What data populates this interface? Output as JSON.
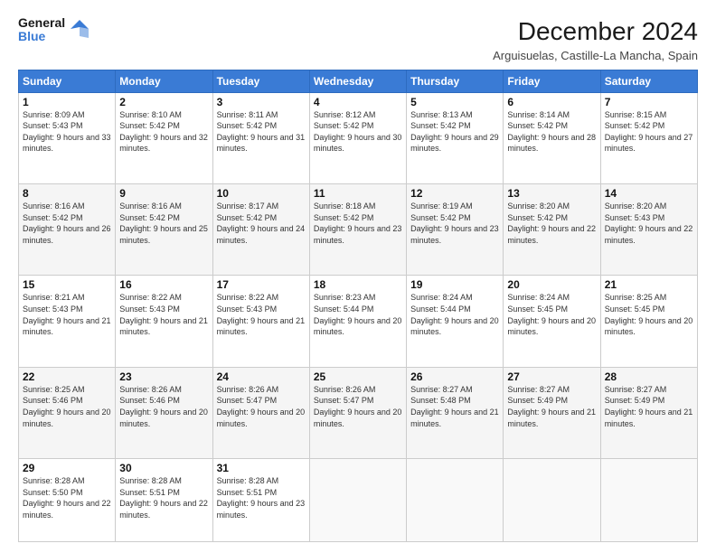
{
  "header": {
    "logo_line1": "General",
    "logo_line2": "Blue",
    "title": "December 2024",
    "subtitle": "Arguisuelas, Castille-La Mancha, Spain"
  },
  "days_of_week": [
    "Sunday",
    "Monday",
    "Tuesday",
    "Wednesday",
    "Thursday",
    "Friday",
    "Saturday"
  ],
  "weeks": [
    [
      {
        "day": 1,
        "sunrise": "8:09 AM",
        "sunset": "5:43 PM",
        "daylight": "9 hours and 33 minutes."
      },
      {
        "day": 2,
        "sunrise": "8:10 AM",
        "sunset": "5:42 PM",
        "daylight": "9 hours and 32 minutes."
      },
      {
        "day": 3,
        "sunrise": "8:11 AM",
        "sunset": "5:42 PM",
        "daylight": "9 hours and 31 minutes."
      },
      {
        "day": 4,
        "sunrise": "8:12 AM",
        "sunset": "5:42 PM",
        "daylight": "9 hours and 30 minutes."
      },
      {
        "day": 5,
        "sunrise": "8:13 AM",
        "sunset": "5:42 PM",
        "daylight": "9 hours and 29 minutes."
      },
      {
        "day": 6,
        "sunrise": "8:14 AM",
        "sunset": "5:42 PM",
        "daylight": "9 hours and 28 minutes."
      },
      {
        "day": 7,
        "sunrise": "8:15 AM",
        "sunset": "5:42 PM",
        "daylight": "9 hours and 27 minutes."
      }
    ],
    [
      {
        "day": 8,
        "sunrise": "8:16 AM",
        "sunset": "5:42 PM",
        "daylight": "9 hours and 26 minutes."
      },
      {
        "day": 9,
        "sunrise": "8:16 AM",
        "sunset": "5:42 PM",
        "daylight": "9 hours and 25 minutes."
      },
      {
        "day": 10,
        "sunrise": "8:17 AM",
        "sunset": "5:42 PM",
        "daylight": "9 hours and 24 minutes."
      },
      {
        "day": 11,
        "sunrise": "8:18 AM",
        "sunset": "5:42 PM",
        "daylight": "9 hours and 23 minutes."
      },
      {
        "day": 12,
        "sunrise": "8:19 AM",
        "sunset": "5:42 PM",
        "daylight": "9 hours and 23 minutes."
      },
      {
        "day": 13,
        "sunrise": "8:20 AM",
        "sunset": "5:42 PM",
        "daylight": "9 hours and 22 minutes."
      },
      {
        "day": 14,
        "sunrise": "8:20 AM",
        "sunset": "5:43 PM",
        "daylight": "9 hours and 22 minutes."
      }
    ],
    [
      {
        "day": 15,
        "sunrise": "8:21 AM",
        "sunset": "5:43 PM",
        "daylight": "9 hours and 21 minutes."
      },
      {
        "day": 16,
        "sunrise": "8:22 AM",
        "sunset": "5:43 PM",
        "daylight": "9 hours and 21 minutes."
      },
      {
        "day": 17,
        "sunrise": "8:22 AM",
        "sunset": "5:43 PM",
        "daylight": "9 hours and 21 minutes."
      },
      {
        "day": 18,
        "sunrise": "8:23 AM",
        "sunset": "5:44 PM",
        "daylight": "9 hours and 20 minutes."
      },
      {
        "day": 19,
        "sunrise": "8:24 AM",
        "sunset": "5:44 PM",
        "daylight": "9 hours and 20 minutes."
      },
      {
        "day": 20,
        "sunrise": "8:24 AM",
        "sunset": "5:45 PM",
        "daylight": "9 hours and 20 minutes."
      },
      {
        "day": 21,
        "sunrise": "8:25 AM",
        "sunset": "5:45 PM",
        "daylight": "9 hours and 20 minutes."
      }
    ],
    [
      {
        "day": 22,
        "sunrise": "8:25 AM",
        "sunset": "5:46 PM",
        "daylight": "9 hours and 20 minutes."
      },
      {
        "day": 23,
        "sunrise": "8:26 AM",
        "sunset": "5:46 PM",
        "daylight": "9 hours and 20 minutes."
      },
      {
        "day": 24,
        "sunrise": "8:26 AM",
        "sunset": "5:47 PM",
        "daylight": "9 hours and 20 minutes."
      },
      {
        "day": 25,
        "sunrise": "8:26 AM",
        "sunset": "5:47 PM",
        "daylight": "9 hours and 20 minutes."
      },
      {
        "day": 26,
        "sunrise": "8:27 AM",
        "sunset": "5:48 PM",
        "daylight": "9 hours and 21 minutes."
      },
      {
        "day": 27,
        "sunrise": "8:27 AM",
        "sunset": "5:49 PM",
        "daylight": "9 hours and 21 minutes."
      },
      {
        "day": 28,
        "sunrise": "8:27 AM",
        "sunset": "5:49 PM",
        "daylight": "9 hours and 21 minutes."
      }
    ],
    [
      {
        "day": 29,
        "sunrise": "8:28 AM",
        "sunset": "5:50 PM",
        "daylight": "9 hours and 22 minutes."
      },
      {
        "day": 30,
        "sunrise": "8:28 AM",
        "sunset": "5:51 PM",
        "daylight": "9 hours and 22 minutes."
      },
      {
        "day": 31,
        "sunrise": "8:28 AM",
        "sunset": "5:51 PM",
        "daylight": "9 hours and 23 minutes."
      },
      null,
      null,
      null,
      null
    ]
  ],
  "labels": {
    "sunrise": "Sunrise:",
    "sunset": "Sunset:",
    "daylight": "Daylight:"
  }
}
